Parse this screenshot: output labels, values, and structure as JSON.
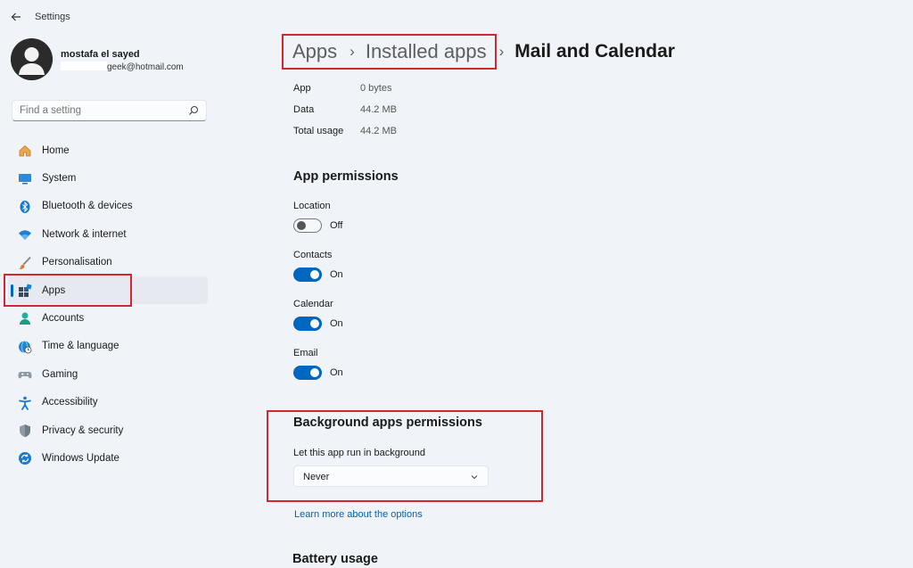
{
  "window": {
    "title": "Settings"
  },
  "profile": {
    "name": "mostafa el sayed",
    "email_suffix": "geek@hotmail.com"
  },
  "search": {
    "placeholder": "Find a setting"
  },
  "sidebar": {
    "items": [
      {
        "label": "Home",
        "icon": "home-icon"
      },
      {
        "label": "System",
        "icon": "system-icon"
      },
      {
        "label": "Bluetooth & devices",
        "icon": "bluetooth-icon"
      },
      {
        "label": "Network & internet",
        "icon": "wifi-icon"
      },
      {
        "label": "Personalisation",
        "icon": "brush-icon"
      },
      {
        "label": "Apps",
        "icon": "apps-icon",
        "active": true
      },
      {
        "label": "Accounts",
        "icon": "accounts-icon"
      },
      {
        "label": "Time & language",
        "icon": "globe-clock-icon"
      },
      {
        "label": "Gaming",
        "icon": "gamepad-icon"
      },
      {
        "label": "Accessibility",
        "icon": "accessibility-icon"
      },
      {
        "label": "Privacy & security",
        "icon": "shield-icon"
      },
      {
        "label": "Windows Update",
        "icon": "update-icon"
      }
    ]
  },
  "breadcrumb": {
    "level1": "Apps",
    "level2": "Installed apps",
    "current": "Mail and Calendar"
  },
  "usage": [
    {
      "label": "App",
      "value": "0 bytes"
    },
    {
      "label": "Data",
      "value": "44.2 MB"
    },
    {
      "label": "Total usage",
      "value": "44.2 MB"
    }
  ],
  "permissions": {
    "heading": "App permissions",
    "items": [
      {
        "label": "Location",
        "state": "Off",
        "on": false
      },
      {
        "label": "Contacts",
        "state": "On",
        "on": true
      },
      {
        "label": "Calendar",
        "state": "On",
        "on": true
      },
      {
        "label": "Email",
        "state": "On",
        "on": true
      }
    ]
  },
  "background": {
    "heading": "Background apps permissions",
    "label": "Let this app run in background",
    "selected": "Never",
    "learn_more": "Learn more about the options"
  },
  "battery": {
    "heading": "Battery usage"
  },
  "colors": {
    "accent": "#0067c0",
    "highlight": "#d6262d",
    "link": "#0062b8"
  }
}
